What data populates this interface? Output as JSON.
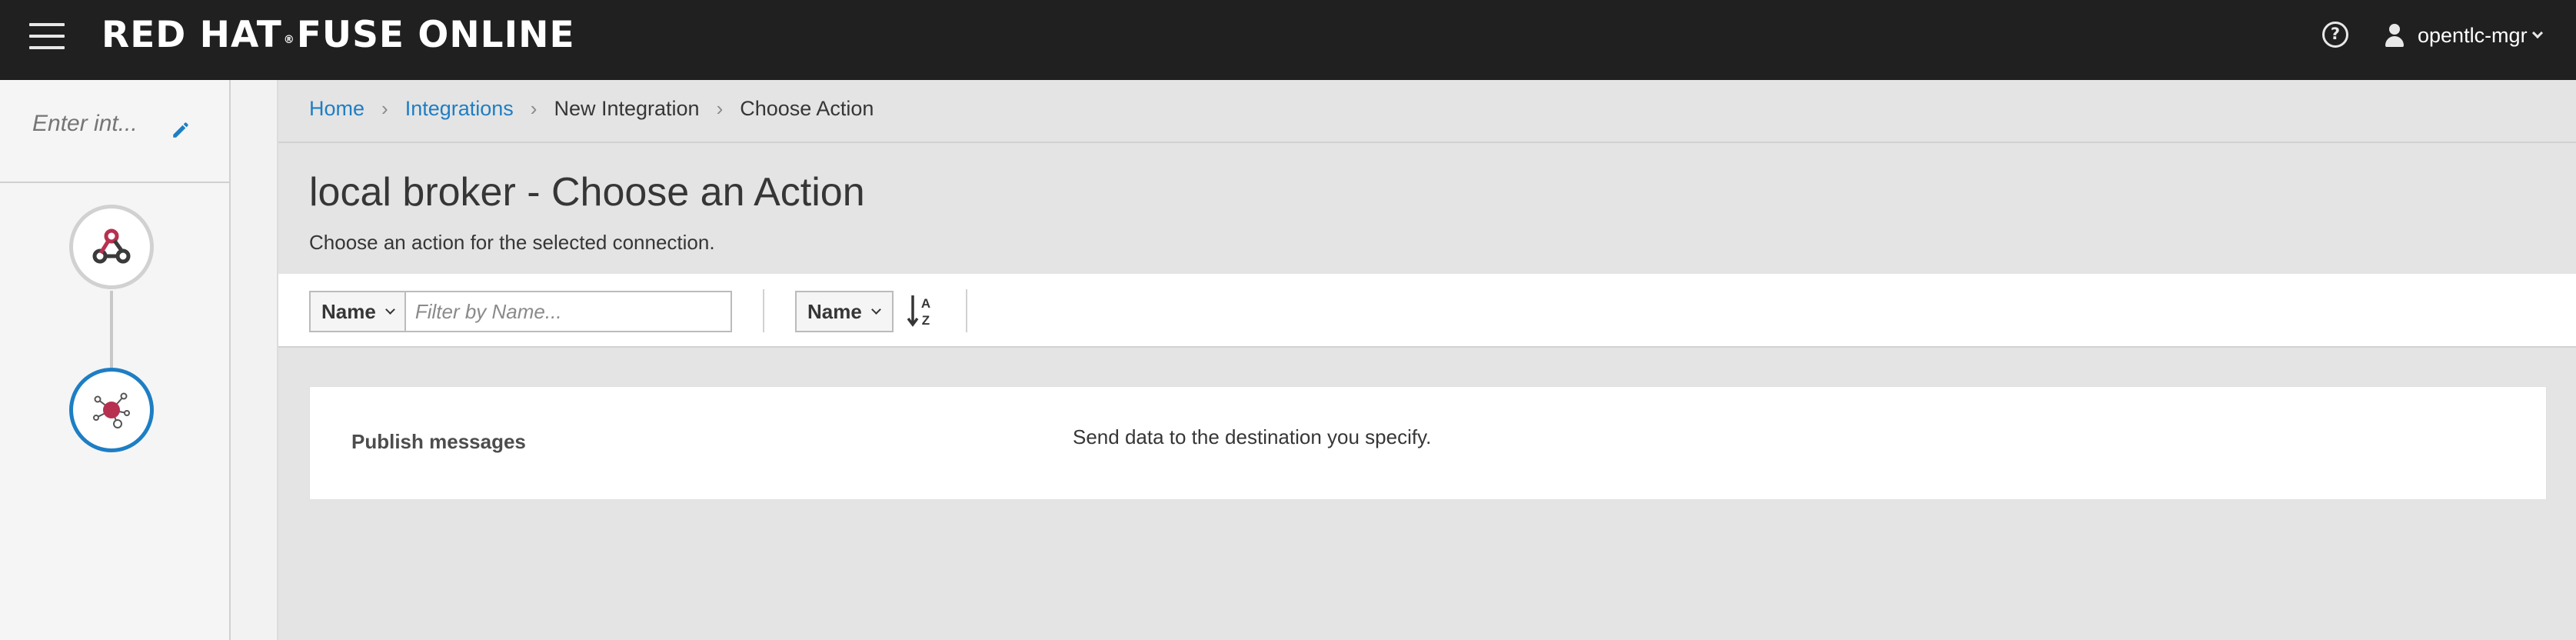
{
  "header": {
    "brand": "RED HAT® FUSE ONLINE",
    "brand_part1": "RED HAT",
    "brand_reg": "®",
    "brand_part2": "FUSE ONLINE",
    "user": "opentlc-mgr"
  },
  "sidebar": {
    "name_placeholder": "Enter int...",
    "steps": [
      {
        "icon": "webhook-icon"
      },
      {
        "icon": "amq-broker-icon"
      }
    ]
  },
  "breadcrumb": {
    "items": [
      "Home",
      "Integrations",
      "New Integration",
      "Choose Action"
    ]
  },
  "page": {
    "title": "local broker - Choose an Action",
    "subtitle": "Choose an action for the selected connection."
  },
  "toolbar": {
    "filter_field": "Name",
    "filter_placeholder": "Filter by Name...",
    "sort_field": "Name"
  },
  "actions": [
    {
      "name": "Publish messages",
      "description": "Send data to the destination you specify."
    }
  ],
  "colors": {
    "accent": "#1e7ec4",
    "topbar": "#202020",
    "step_icon": "#b7304f"
  }
}
